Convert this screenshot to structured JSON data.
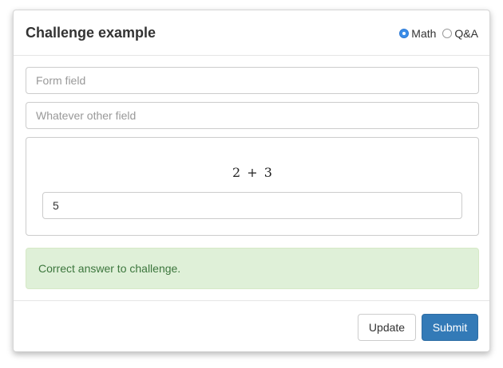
{
  "dialog": {
    "title": "Challenge example",
    "mode_options": [
      {
        "label": "Math",
        "selected": true
      },
      {
        "label": "Q&A",
        "selected": false
      }
    ]
  },
  "form": {
    "field1_placeholder": "Form field",
    "field2_placeholder": "Whatever other field",
    "challenge": {
      "equation": "2 + 3",
      "answer_value": "5"
    },
    "alert_text": "Correct answer to challenge."
  },
  "footer": {
    "update_label": "Update",
    "submit_label": "Submit"
  },
  "colors": {
    "primary": "#337ab7",
    "radio_selected": "#3b8de8",
    "success_bg": "#dff0d8",
    "success_text": "#3c763d"
  }
}
